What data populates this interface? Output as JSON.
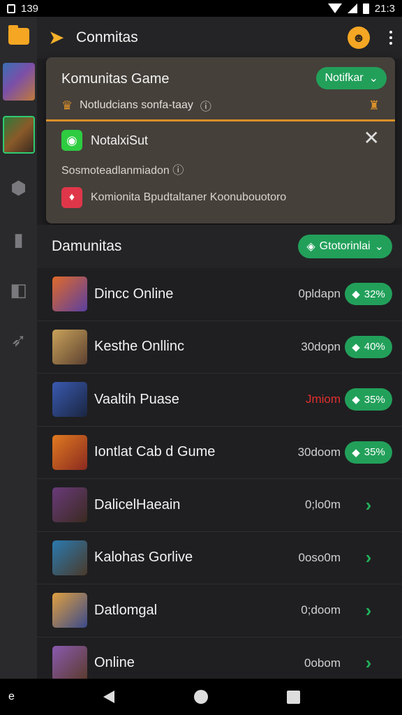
{
  "status_bar": {
    "time_left": "139",
    "time_right": "21:3"
  },
  "app": {
    "title": "Conmitas"
  },
  "notification": {
    "title": "Komunitas Game",
    "button_label": "Notifkar",
    "subtitle": "Notludcians sonfa-taay",
    "card_title": "NotalxiSut",
    "card_text": "Sosmoteadlanmiadon",
    "card_message": "Komionita Bpudtaltaner Koonubouotoro"
  },
  "section": {
    "title": "Damunitas",
    "filter_label": "Gtotorinlai"
  },
  "games": [
    {
      "name": "Dincc Online",
      "meta": "0pldapn",
      "meta_color": "normal",
      "badge": "32%",
      "thumb": [
        "#e06a2a",
        "#5a3fa0"
      ]
    },
    {
      "name": "Kesthe Onllinc",
      "meta": "30dopn",
      "meta_color": "normal",
      "badge": "40%",
      "thumb": [
        "#c9a35a",
        "#5c4030"
      ]
    },
    {
      "name": "Vaaltih Puase",
      "meta": "Jmiom",
      "meta_color": "red",
      "badge": "35%",
      "thumb": [
        "#3a5ab0",
        "#1a2540"
      ]
    },
    {
      "name": "Iontlat Cab d Gume",
      "meta": "30doom",
      "meta_color": "normal",
      "badge": "35%",
      "thumb": [
        "#e07a20",
        "#8a2a20"
      ]
    },
    {
      "name": "DalicelHaeain",
      "meta": "0;lo0m",
      "meta_color": "normal",
      "badge": "",
      "thumb": [
        "#6a3a7a",
        "#3a2a20"
      ]
    },
    {
      "name": "Kalohas Gorlive",
      "meta": "0oso0m",
      "meta_color": "normal",
      "badge": "",
      "thumb": [
        "#2a7ab0",
        "#4a3a2a"
      ]
    },
    {
      "name": "Datlomgal",
      "meta": "0;doom",
      "meta_color": "normal",
      "badge": "",
      "thumb": [
        "#e0a040",
        "#3a4a8a"
      ]
    },
    {
      "name": "Online",
      "meta": "0obom",
      "meta_color": "normal",
      "badge": "",
      "thumb": [
        "#8a5ab0",
        "#5a3a2a"
      ]
    }
  ],
  "nav": {
    "left_glyph": "e"
  },
  "colors": {
    "accent": "#22a05a",
    "warning": "#d9902a",
    "danger": "#e23030"
  }
}
